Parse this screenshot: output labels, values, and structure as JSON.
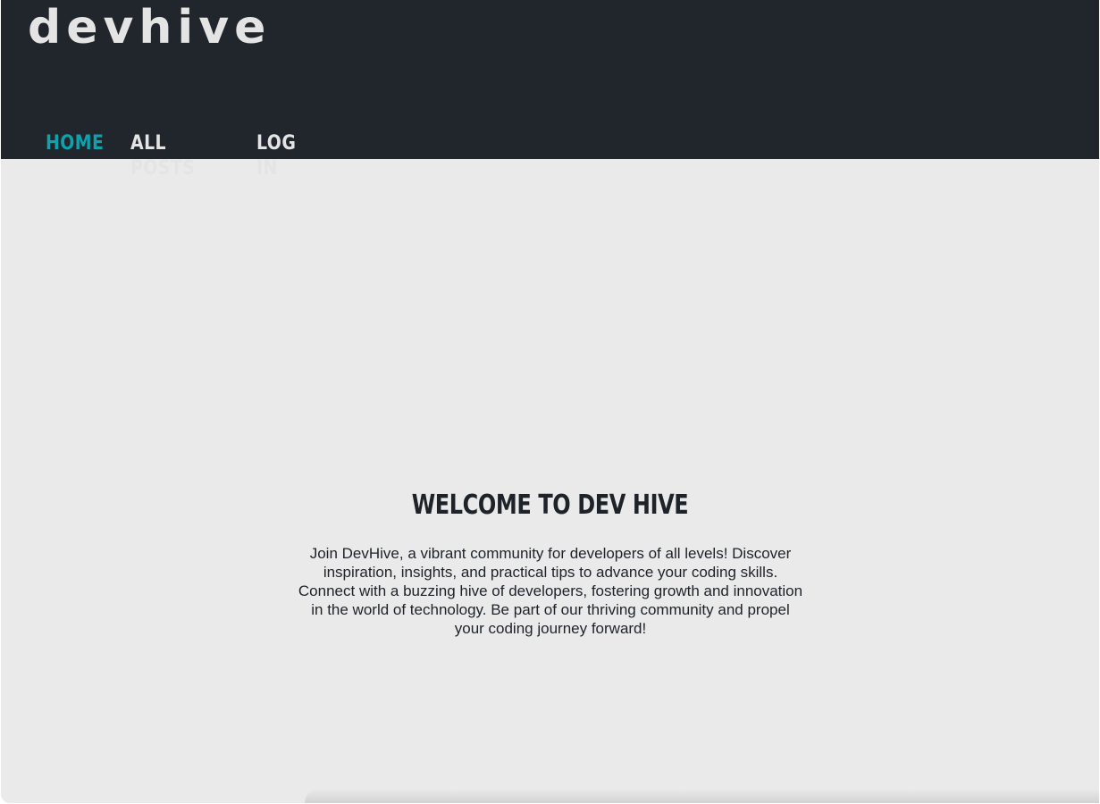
{
  "header": {
    "logo": "devhive",
    "nav": [
      {
        "label": "Home",
        "active": true
      },
      {
        "label": "All Posts",
        "active": false
      },
      {
        "label": "Log In",
        "active": false
      }
    ]
  },
  "hero": {
    "title": "Welcome to Dev Hive",
    "description": "Join DevHive, a vibrant community for developers of all levels! Discover inspiration, insights, and practical tips to advance your coding skills. Connect with a buzzing hive of developers, fostering growth and innovation in the world of technology. Be part of our thriving community and propel your coding journey forward!"
  },
  "colors": {
    "header_bg": "#21252c",
    "page_bg": "#eaeaea",
    "accent": "#0fa1ac",
    "text_light": "#e4e4e4",
    "text_dark": "#1e2229"
  }
}
